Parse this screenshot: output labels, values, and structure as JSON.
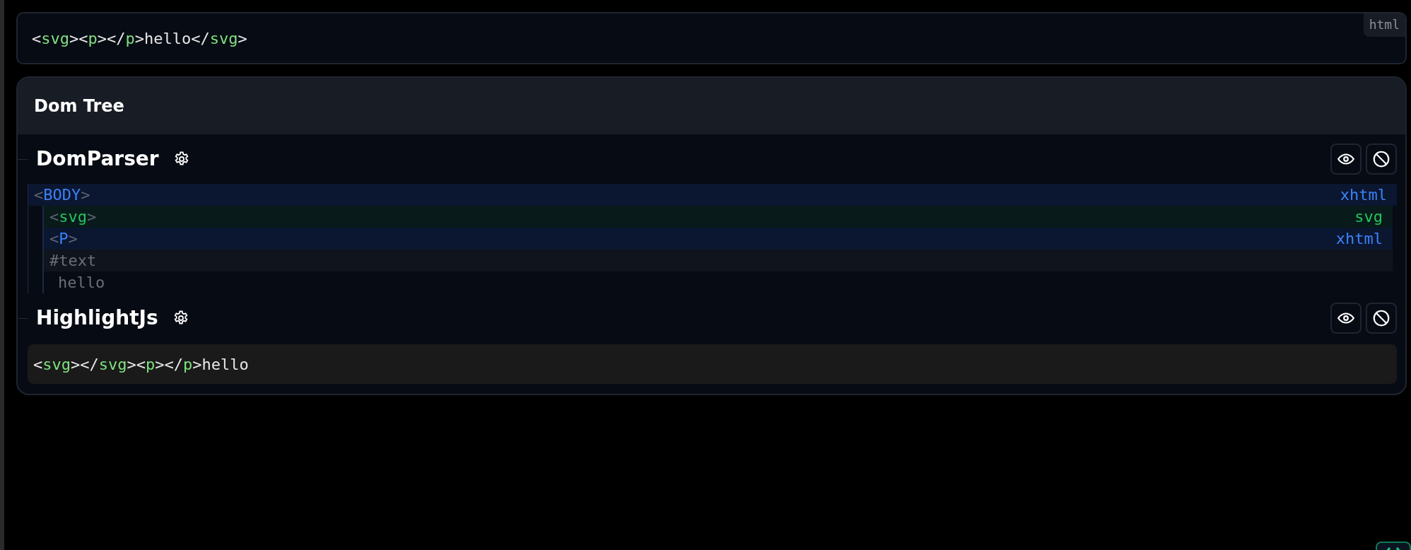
{
  "input": {
    "language": "html",
    "tokens": [
      {
        "text": "<",
        "kind": "punct"
      },
      {
        "text": "svg",
        "kind": "tag"
      },
      {
        "text": "><",
        "kind": "punct"
      },
      {
        "text": "p",
        "kind": "tag"
      },
      {
        "text": "></",
        "kind": "punct"
      },
      {
        "text": "p",
        "kind": "tag"
      },
      {
        "text": ">hello</",
        "kind": "punct"
      },
      {
        "text": "svg",
        "kind": "tag"
      },
      {
        "text": ">",
        "kind": "punct"
      }
    ]
  },
  "panel": {
    "title": "Dom Tree",
    "sections": [
      {
        "title": "DomParser",
        "kind": "tree",
        "tree": [
          {
            "kind": "html",
            "open": "<",
            "name": "BODY",
            "close": ">",
            "namespace": "xhtml",
            "children": [
              {
                "kind": "svg",
                "open": "<",
                "name": "svg",
                "close": ">",
                "namespace": "svg"
              },
              {
                "kind": "html",
                "open": "<",
                "name": "P",
                "close": ">",
                "namespace": "xhtml"
              },
              {
                "kind": "text",
                "name": "#text",
                "value": "hello"
              }
            ]
          }
        ]
      },
      {
        "title": "HighlightJs",
        "kind": "code",
        "tokens": [
          {
            "text": "<",
            "kind": "punct"
          },
          {
            "text": "svg",
            "kind": "tag"
          },
          {
            "text": "></",
            "kind": "punct"
          },
          {
            "text": "svg",
            "kind": "tag"
          },
          {
            "text": "><",
            "kind": "punct"
          },
          {
            "text": "p",
            "kind": "tag"
          },
          {
            "text": "></",
            "kind": "punct"
          },
          {
            "text": "p",
            "kind": "tag"
          },
          {
            "text": ">hello",
            "kind": "punct"
          }
        ]
      }
    ]
  }
}
